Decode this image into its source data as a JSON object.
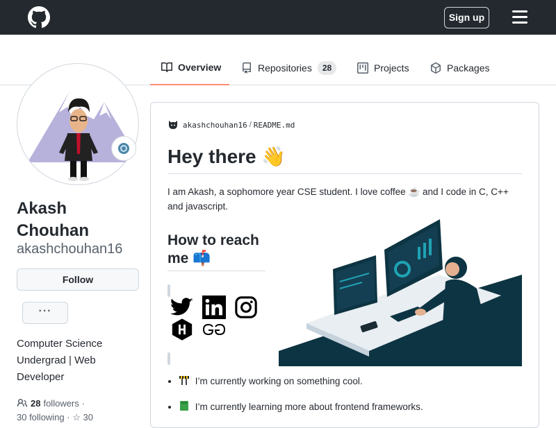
{
  "header": {
    "signup_label": "Sign up",
    "logo_icon": "github-icon",
    "menu_icon": "hamburger-icon",
    "text_color": "#ffffff",
    "background": "#24292f"
  },
  "tabs": [
    {
      "label": "Overview",
      "icon": "book-icon",
      "active": true
    },
    {
      "label": "Repositories",
      "icon": "repo-icon",
      "count": "28"
    },
    {
      "label": "Projects",
      "icon": "project-icon"
    },
    {
      "label": "Packages",
      "icon": "package-icon"
    }
  ],
  "profile": {
    "name": "Akash Chouhan",
    "username": "akashchouhan16",
    "follow_label": "Follow",
    "more_label": "···",
    "bio": "Computer Science Undergrad | Web Developer",
    "followers_count": "28",
    "followers_label": "followers",
    "followers_sep": "·",
    "following_text": "30 following · ☆ 30",
    "status_icon": "status-emoji-icon",
    "avatar_icon": "avatar-bitmoji-icon"
  },
  "readme": {
    "owner": "akashchouhan16",
    "separator": "/",
    "file": "README.md",
    "title": "Hey there 👋",
    "intro": "I am Akash, a sophomore year CSE student. I love coffee ☕ and I code in C, C++ and javascript.",
    "reach_heading": "How to reach me 📫",
    "social_icons": [
      "twitter-icon",
      "linkedin-icon",
      "instagram-icon",
      "hackerrank-icon",
      "geeksforgeeks-icon"
    ],
    "bullets": [
      {
        "emoji_icon": "construction-icon",
        "text": "I’m currently working on something cool."
      },
      {
        "emoji_icon": "book-green-icon",
        "text": "I’m currently learning more about frontend frameworks."
      }
    ]
  },
  "colors": {
    "accent_tab_underline": "#fd8c73",
    "illustration_dark": "#0d3442",
    "illustration_teal": "#1fa3b5"
  }
}
